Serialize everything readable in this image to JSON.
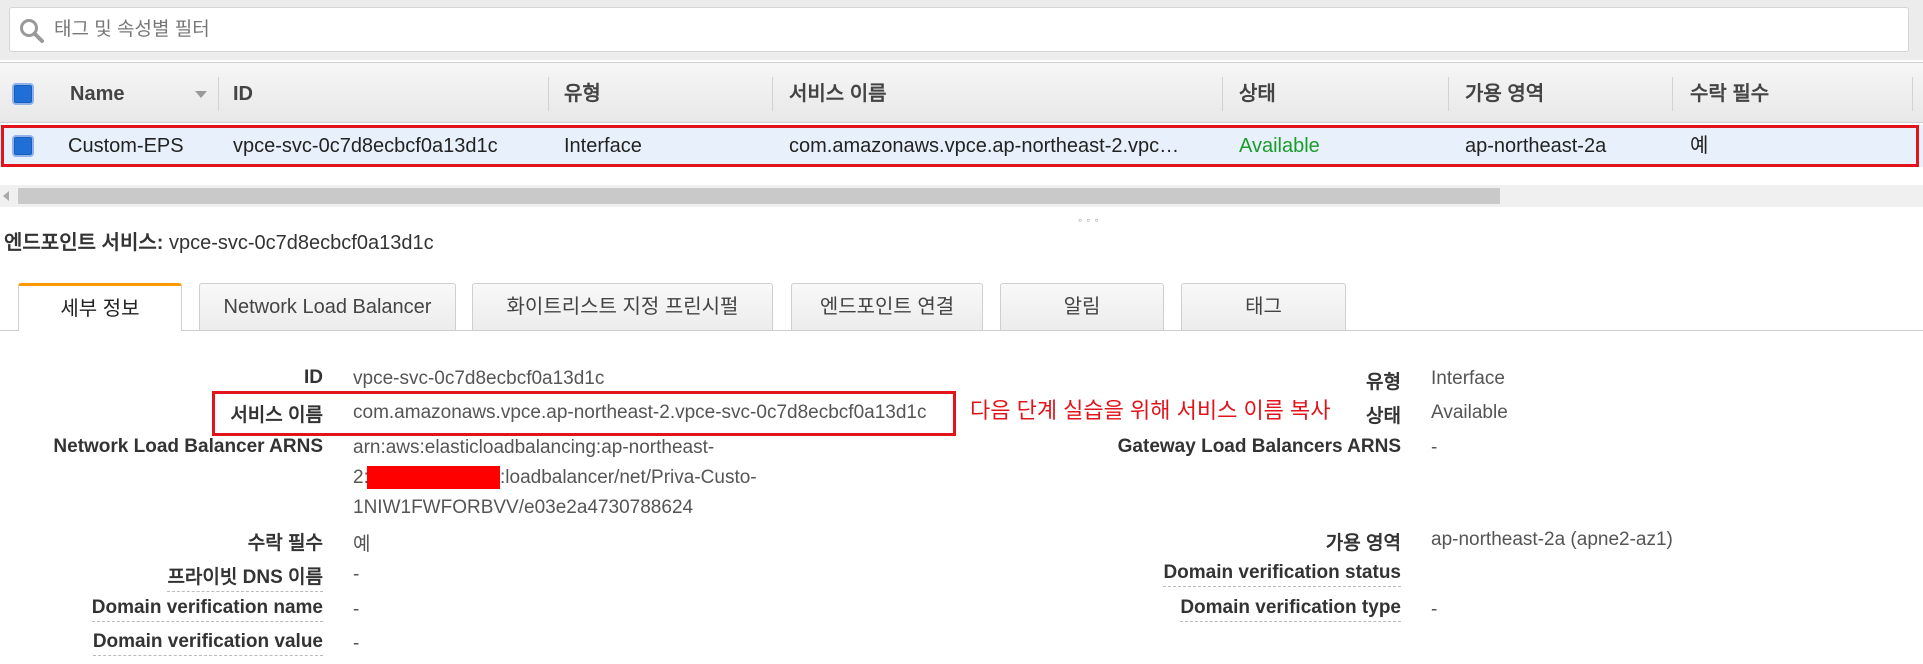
{
  "search": {
    "placeholder": "태그 및 속성별 필터"
  },
  "table": {
    "headers": [
      "Name",
      "ID",
      "유형",
      "서비스 이름",
      "상태",
      "가용 영역",
      "수락 필수"
    ],
    "row": {
      "name": "Custom-EPS",
      "id": "vpce-svc-0c7d8ecbcf0a13d1c",
      "type": "Interface",
      "service_name": "com.amazonaws.vpce.ap-northeast-2.vpc…",
      "state": "Available",
      "az": "ap-northeast-2a",
      "acceptance": "예"
    }
  },
  "detail": {
    "title_label": "엔드포인트 서비스:",
    "title_value": "vpce-svc-0c7d8ecbcf0a13d1c",
    "tabs": [
      "세부 정보",
      "Network Load Balancer",
      "화이트리스트 지정 프린시펄",
      "엔드포인트 연결",
      "알림",
      "태그"
    ],
    "left": [
      {
        "label": "ID",
        "value": "vpce-svc-0c7d8ecbcf0a13d1c"
      },
      {
        "label": "서비스 이름",
        "value": "com.amazonaws.vpce.ap-northeast-2.vpce-svc-0c7d8ecbcf0a13d1c"
      },
      {
        "label": "Network Load Balancer ARNS",
        "value_lines": [
          "arn:aws:elasticloadbalancing:ap-northeast-",
          "2:",
          ":loadbalancer/net/Priva-Custo-",
          "1NIW1FWFORBVV/e03e2a4730788624"
        ]
      },
      {
        "label": "수락 필수",
        "value": "예"
      },
      {
        "label": "프라이빗 DNS 이름",
        "value": "-"
      },
      {
        "label": "Domain verification name",
        "value": "-"
      },
      {
        "label": "Domain verification value",
        "value": "-"
      }
    ],
    "right": [
      {
        "label": "유형",
        "value": "Interface"
      },
      {
        "label": "상태",
        "value": "Available"
      },
      {
        "label": "Gateway Load Balancers ARNS",
        "value": "-"
      },
      {
        "label": "가용 영역",
        "value": "ap-northeast-2a (apne2-az1)"
      },
      {
        "label": "Domain verification status",
        "value": ""
      },
      {
        "label": "Domain verification type",
        "value": "-"
      }
    ]
  },
  "annotation": {
    "text": "다음 단계 실습을 위해 서비스 이름 복사"
  },
  "colors": {
    "accent_red": "#e1141b",
    "available_green": "#1a9c2b",
    "checkbox_blue": "#1f6fd6",
    "tab_active_orange": "#ff9900"
  }
}
